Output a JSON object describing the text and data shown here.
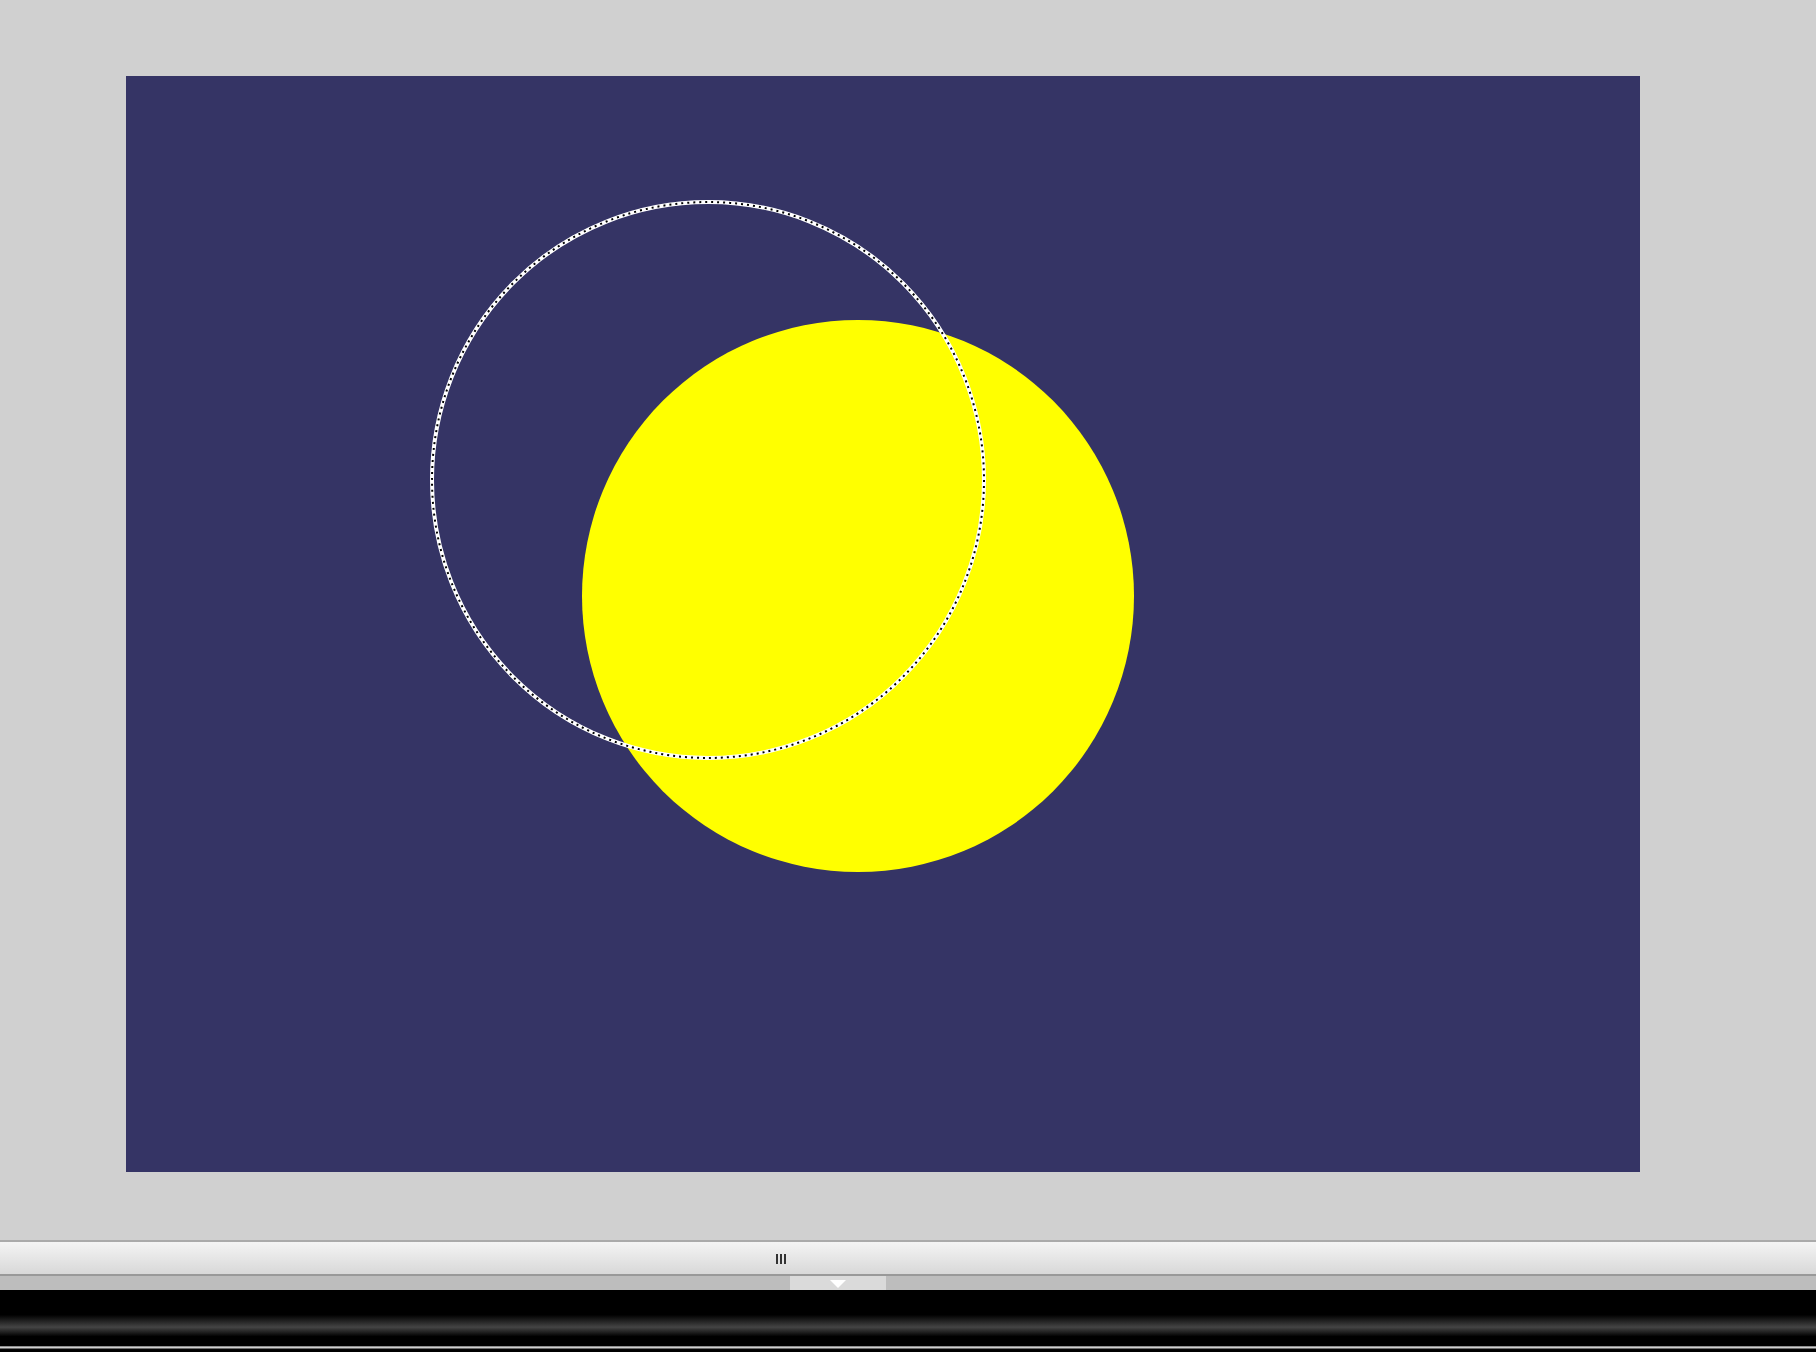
{
  "canvas": {
    "shapes": [
      {
        "kind": "disc"
      },
      {
        "kind": "selection"
      }
    ]
  }
}
